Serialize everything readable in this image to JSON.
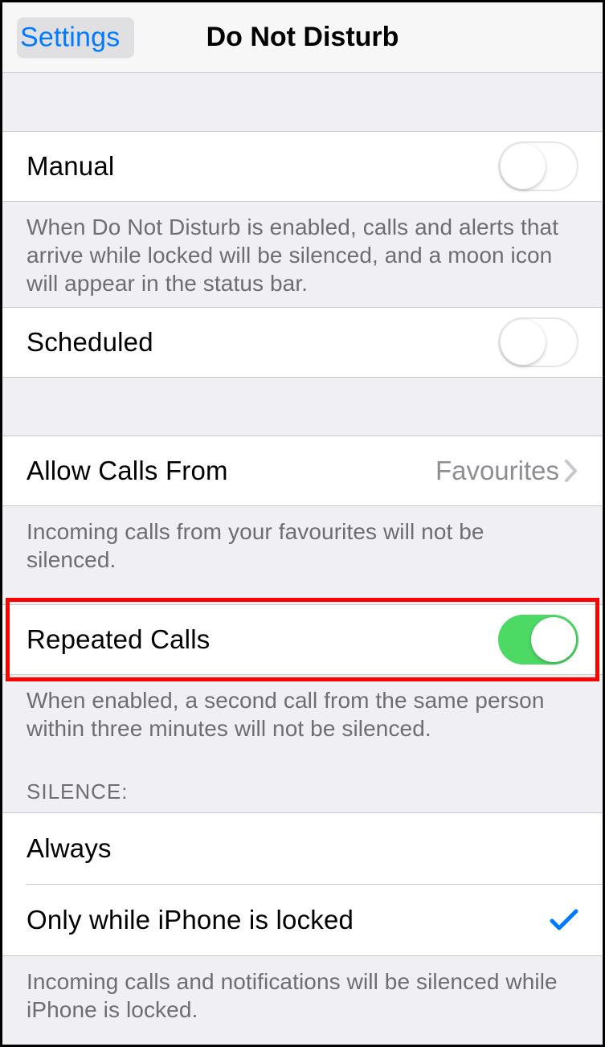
{
  "nav": {
    "back_label": "Settings",
    "title": "Do Not Disturb"
  },
  "manual": {
    "label": "Manual",
    "footer": "When Do Not Disturb is enabled, calls and alerts that arrive while locked will be silenced, and a moon icon will appear in the status bar."
  },
  "scheduled": {
    "label": "Scheduled"
  },
  "allow_calls": {
    "label": "Allow Calls From",
    "value": "Favourites",
    "footer": "Incoming calls from your favourites will not be silenced."
  },
  "repeated": {
    "label": "Repeated Calls",
    "footer": "When enabled, a second call from the same person within three minutes will not be silenced."
  },
  "silence": {
    "header": "SILENCE:",
    "always": "Always",
    "locked": "Only while iPhone is locked",
    "footer": "Incoming calls and notifications will be silenced while iPhone is locked."
  }
}
